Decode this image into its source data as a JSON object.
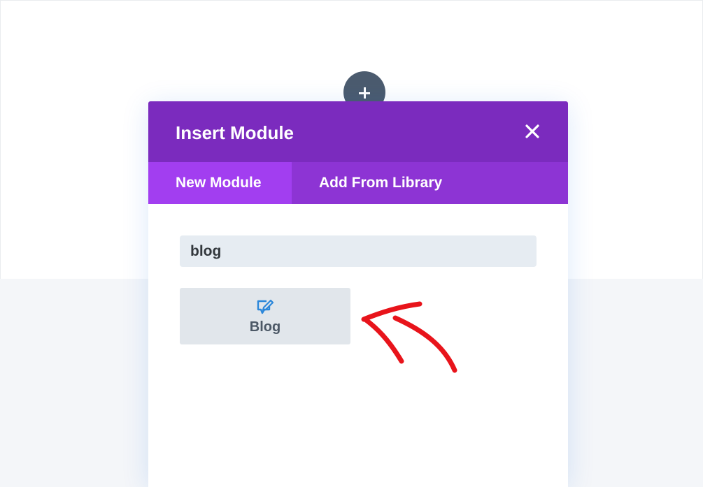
{
  "modal": {
    "title": "Insert Module",
    "close_icon": "close-icon",
    "tabs": [
      {
        "label": "New Module",
        "active": true
      },
      {
        "label": "Add From Library",
        "active": false
      }
    ],
    "search": {
      "value": "blog",
      "placeholder": ""
    },
    "results": [
      {
        "label": "Blog",
        "icon": "blog-icon"
      }
    ]
  },
  "colors": {
    "header": "#7b2bbe",
    "tabs_bar": "#8d34d4",
    "active_tab": "#a23ef0",
    "add_button": "#4b5b6e",
    "annotation_arrow": "#e8141b",
    "module_icon": "#2b87da"
  }
}
